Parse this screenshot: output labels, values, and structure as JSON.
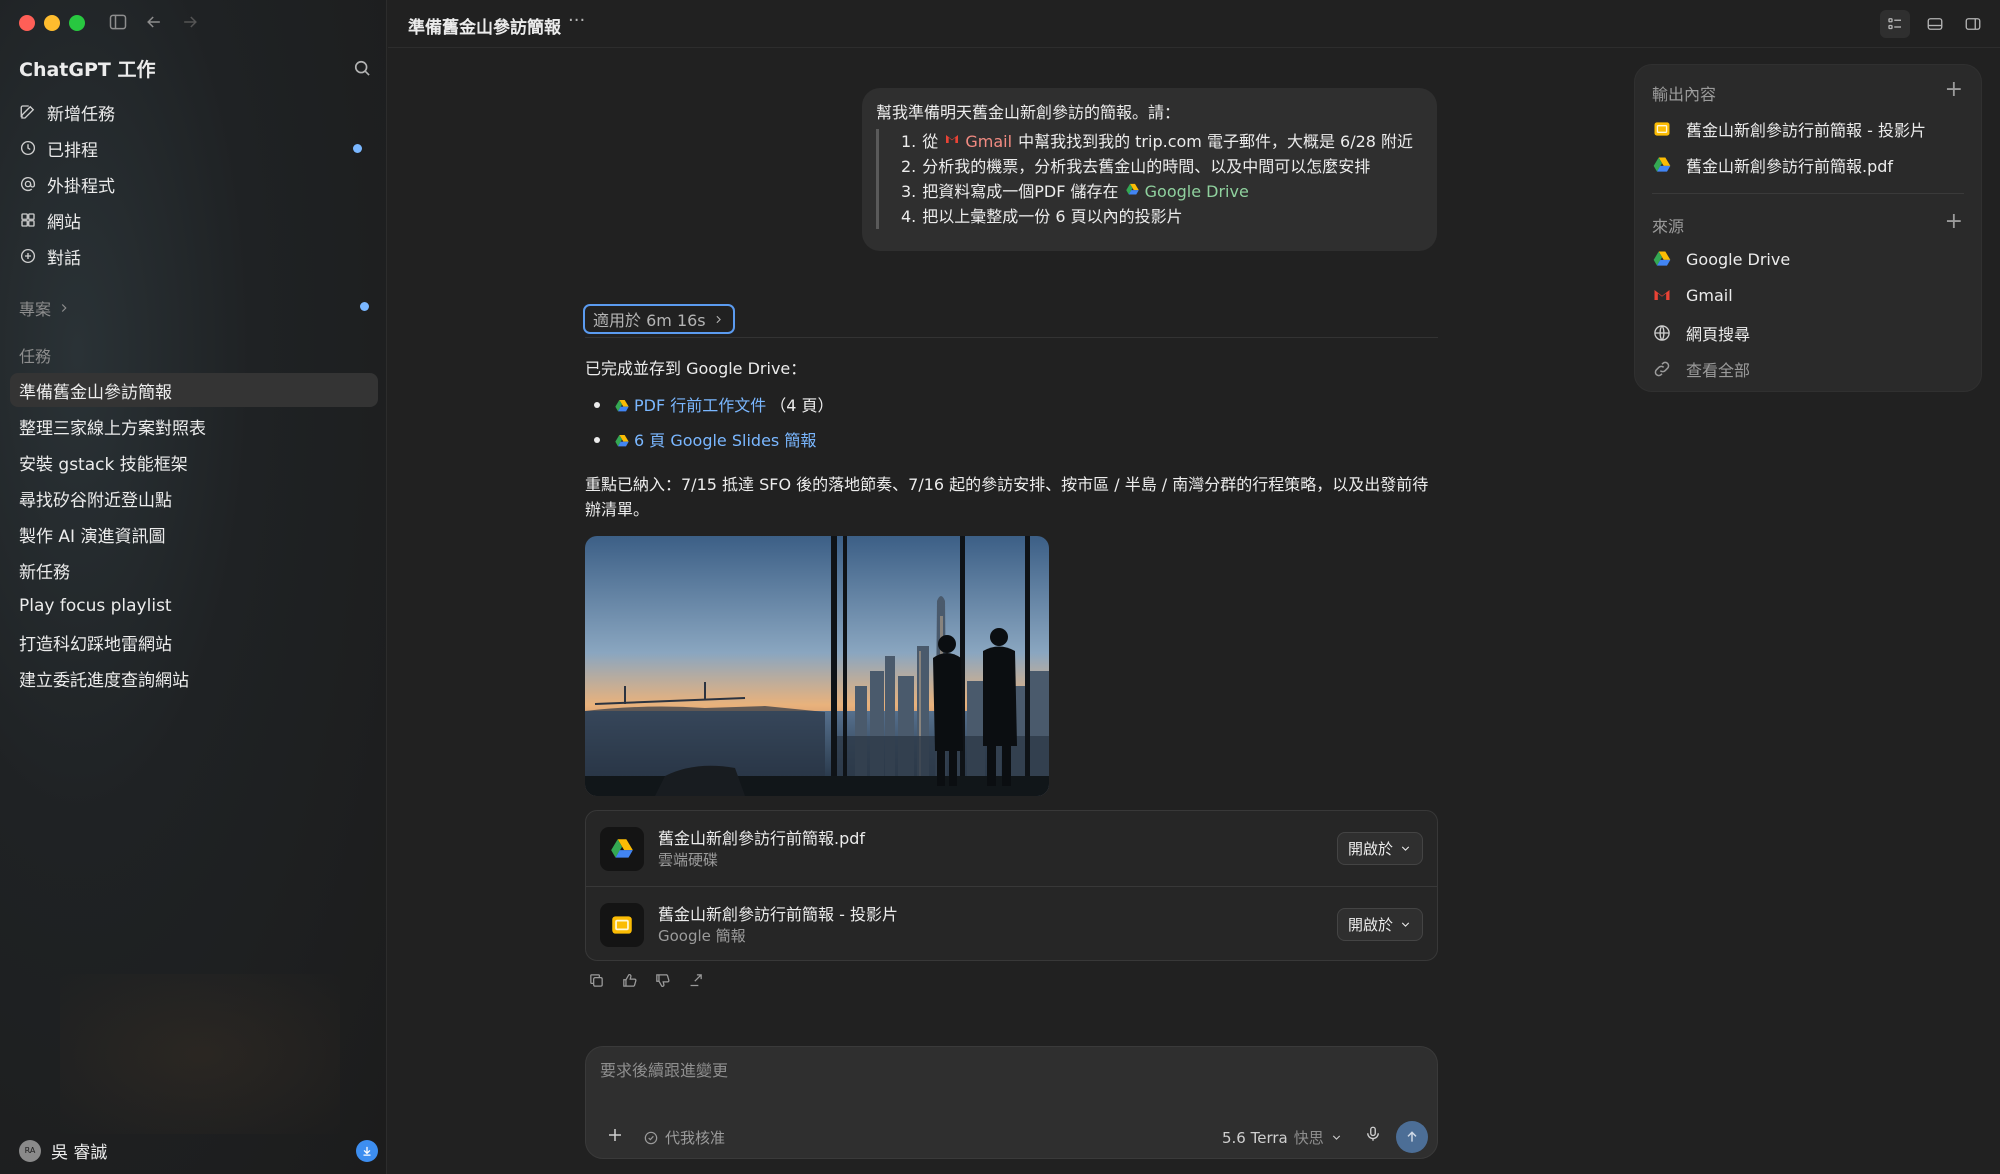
{
  "sidebar": {
    "title": "ChatGPT 工作",
    "nav": [
      {
        "label": "新增任務",
        "icon": "edit-icon"
      },
      {
        "label": "已排程",
        "icon": "clock-icon"
      },
      {
        "label": "外掛程式",
        "icon": "at-icon"
      },
      {
        "label": "網站",
        "icon": "grid-icon"
      },
      {
        "label": "對話",
        "icon": "chat-plus-icon"
      }
    ],
    "projects_label": "專案",
    "tasks_label": "任務",
    "tasks": [
      "準備舊金山參訪簡報",
      "整理三家線上方案對照表",
      "安裝 gstack 技能框架",
      "尋找矽谷附近登山點",
      "製作 AI 演進資訊圖",
      "新任務",
      "Play focus playlist",
      "打造科幻踩地雷網站",
      "建立委託進度查詢網站"
    ],
    "user": {
      "initials": "RA",
      "name": "吳 睿誠"
    }
  },
  "topbar": {
    "title": "準備舊金山參訪簡報",
    "more": "···"
  },
  "user_message": {
    "intro": "幫我準備明天舊金山新創參訪的簡報。請：",
    "items": [
      {
        "num": "1.",
        "pre": "從",
        "chip": "Gmail",
        "post": "中幫我找到我的 trip.com 電子郵件，大概是 6/28 附近"
      },
      {
        "num": "2.",
        "text": "分析我的機票，分析我去舊金山的時間、以及中間可以怎麼安排"
      },
      {
        "num": "3.",
        "pre": "把資料寫成一個PDF 儲存在",
        "chip": "Google Drive"
      },
      {
        "num": "4.",
        "text": "把以上彙整成一份 6 頁以內的投影片"
      }
    ]
  },
  "assistant": {
    "worked_label": "適用於 6m 16s",
    "saved_line": "已完成並存到 Google Drive：",
    "links": [
      {
        "link": "PDF 行前工作文件",
        "suffix": "（4 頁）"
      },
      {
        "link": "6 頁 Google Slides 簡報",
        "suffix": ""
      }
    ],
    "summary_1": "重點已納入：7/15 抵達 SFO 後的落地節奏、7/16 起的參訪安排、按市區 / 半島 / 南灣分群的行程策略，以及出發前待",
    "summary_2": "辦清單。",
    "files": [
      {
        "name": "舊金山新創參訪行前簡報.pdf",
        "sub": "雲端硬碟",
        "icon": "google-drive-icon",
        "open": "開啟於"
      },
      {
        "name": "舊金山新創參訪行前簡報 - 投影片",
        "sub": "Google 簡報",
        "icon": "google-slides-icon",
        "open": "開啟於"
      }
    ]
  },
  "composer": {
    "placeholder": "要求後續跟進變更",
    "approve_label": "代我核准",
    "model": "5.6 Terra",
    "speed": "快思"
  },
  "right_panel": {
    "outputs_label": "輸出內容",
    "outputs": [
      {
        "label": "舊金山新創參訪行前簡報 - 投影片",
        "icon": "google-slides-icon"
      },
      {
        "label": "舊金山新創參訪行前簡報.pdf",
        "icon": "google-drive-icon"
      }
    ],
    "sources_label": "來源",
    "sources": [
      {
        "label": "Google Drive",
        "icon": "google-drive-icon"
      },
      {
        "label": "Gmail",
        "icon": "gmail-icon"
      },
      {
        "label": "網頁搜尋",
        "icon": "globe-icon"
      },
      {
        "label": "查看全部",
        "icon": "link-icon"
      }
    ]
  },
  "colors": {
    "accent": "#7ab7ff",
    "background": "#212121",
    "sidebar": "#1c1c1c",
    "focus_ring": "#5b9bf0"
  }
}
